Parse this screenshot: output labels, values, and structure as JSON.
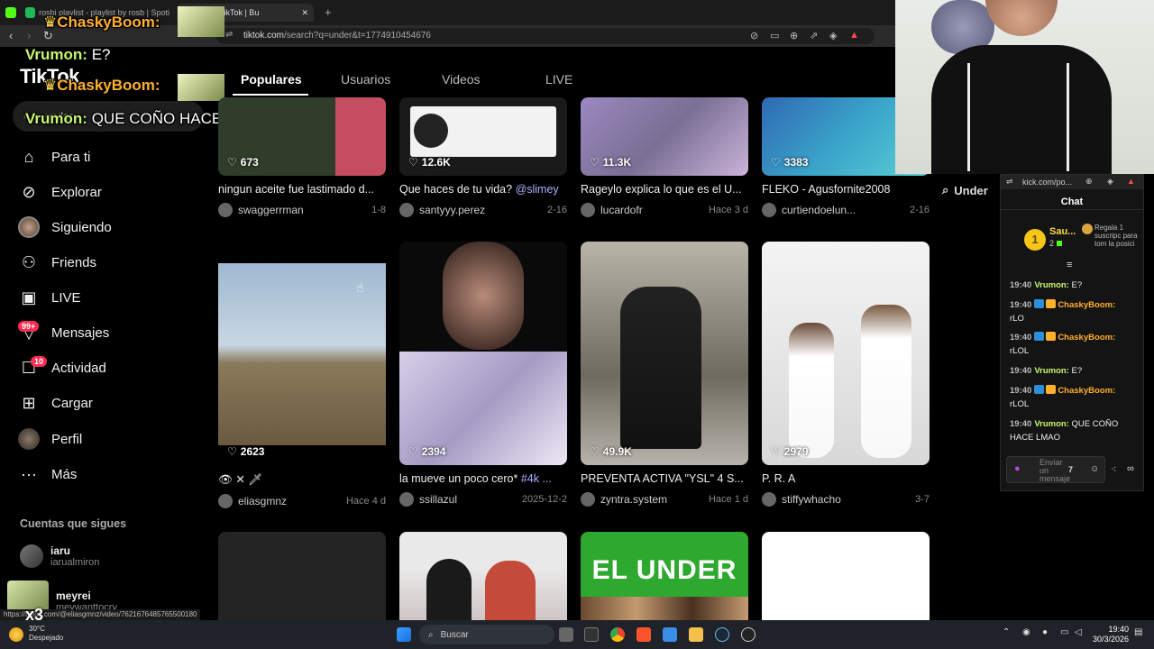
{
  "browser": {
    "tabs": [
      {
        "label": "rosbi playlist - playlist by rosb | Spoti"
      },
      {
        "label": "'under' en TikTok | Bu"
      }
    ],
    "new_tab_icon": "plus-icon",
    "url_host": "tiktok.com",
    "url_path": "/search?q=under&t=1774910454676",
    "status_url": "https://tiktok.com/@eliasgmnz/video/7621676485765500180"
  },
  "tiktok": {
    "logo": "TikTok",
    "search_value": "under",
    "nav": [
      {
        "label": "Para ti",
        "icon": "home-icon"
      },
      {
        "label": "Explorar",
        "icon": "compass-icon"
      },
      {
        "label": "Siguiendo",
        "icon": "following-avatar-icon"
      },
      {
        "label": "Friends",
        "icon": "friends-icon"
      },
      {
        "label": "LIVE",
        "icon": "live-tv-icon"
      },
      {
        "label": "Mensajes",
        "icon": "message-icon",
        "badge": "99+"
      },
      {
        "label": "Actividad",
        "icon": "activity-icon",
        "badge": "10"
      },
      {
        "label": "Cargar",
        "icon": "upload-icon"
      },
      {
        "label": "Perfil",
        "icon": "profile-avatar-icon"
      },
      {
        "label": "Más",
        "icon": "more-icon"
      }
    ],
    "following_header": "Cuentas que sigues",
    "following": [
      {
        "name": "iaru",
        "user": "iarualmiron"
      },
      {
        "name": "meyrei",
        "user": "meywanttocry"
      }
    ],
    "tabs": [
      "Populares",
      "Usuarios",
      "Videos",
      "LIVE"
    ],
    "right_search": "Under",
    "videos": [
      {
        "likes": "673",
        "title": "ningun aceite fue lastimado d...",
        "user": "swaggerrman",
        "date": "1-8",
        "color": "#3a4a3a"
      },
      {
        "likes": "12.6K",
        "title": "Que haces de tu vida? ",
        "tag": "@slimey",
        "user": "santyyy.perez",
        "date": "2-16",
        "color": "#d9d9d9"
      },
      {
        "likes": "11.3K",
        "title": "Rageylo explica lo que es el U...",
        "user": "lucardofr",
        "date": "Hace 3 d",
        "color": "#8d7fa8"
      },
      {
        "likes": "3383",
        "title": "FLEKO - Agusfornite2008",
        "user": "curtiendoelun...",
        "date": "2-16",
        "color": "#3b6ea8"
      },
      {
        "likes": "2623",
        "title": "",
        "user": "eliasgmnz",
        "date": "Hace 4 d",
        "color": "#8fa3b4"
      },
      {
        "likes": "2394",
        "title": "la mueve un poco cero* ",
        "tag": "#4k ...",
        "user": "ssillazul",
        "date": "2025-12-2",
        "color": "#b8b0d0"
      },
      {
        "likes": "49.9K",
        "title": "PREVENTA ACTIVA \"YSL\" 4 S...",
        "user": "zyntra.system",
        "date": "Hace 1 d",
        "color": "#8a8577"
      },
      {
        "likes": "2979",
        "title": "P. R. A",
        "user": "stiffywhacho",
        "date": "3-7",
        "color": "#e6e6e6"
      }
    ],
    "row3_label": "EL UNDER"
  },
  "overlay_chat": [
    {
      "user": "ChaskyBoom:",
      "msg": ""
    },
    {
      "user": "Vrumon:",
      "msg": "E?"
    },
    {
      "user": "ChaskyBoom:",
      "msg": ""
    },
    {
      "user": "Vrumon:",
      "msg": "QUE COÑO HACE"
    }
  ],
  "kick": {
    "url": "kick.com/po...",
    "header": "Chat",
    "top_gifter": "Sau...",
    "gifter_count": "2",
    "gift_text": "Regala 1 suscripc para tom la posici",
    "messages": [
      {
        "time": "19:40",
        "user": "Vrumon:",
        "msg": "E?",
        "color": "#c8f76b"
      },
      {
        "time": "19:40",
        "user": "ChaskyBoom:",
        "msg": "rLO",
        "color": "#ffb02e"
      },
      {
        "time": "19:40",
        "user": "ChaskyBoom:",
        "msg": "rLOL",
        "color": "#ffb02e"
      },
      {
        "time": "19:40",
        "user": "Vrumon:",
        "msg": "E?",
        "color": "#c8f76b"
      },
      {
        "time": "19:40",
        "user": "ChaskyBoom:",
        "msg": "rLOL",
        "color": "#ffb02e"
      },
      {
        "time": "19:40",
        "user": "Vrumon:",
        "msg": "QUE COÑO HACE LMAO",
        "color": "#c8f76b"
      }
    ],
    "input_placeholder": "Enviar un mensaje"
  },
  "taskbar": {
    "weather_temp": "30°C",
    "weather_text": "Despejado",
    "search_placeholder": "Buscar",
    "time": "19:40",
    "date": "30/3/2026"
  },
  "colors": {
    "accent": "#fe2c55",
    "kick_green": "#53fc18"
  }
}
